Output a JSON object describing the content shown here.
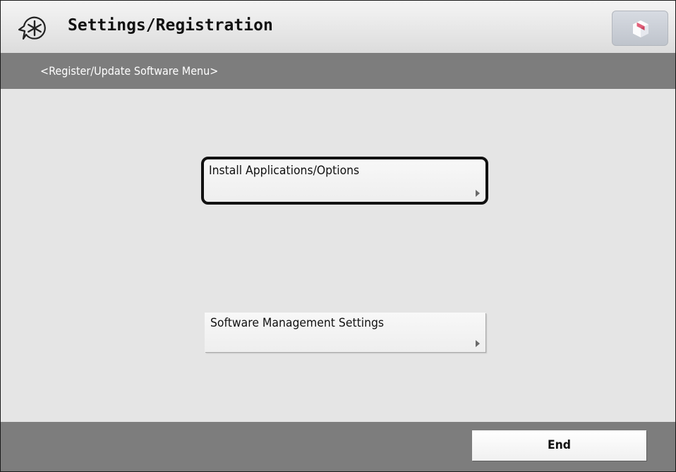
{
  "header": {
    "title": "Settings/Registration",
    "icon": "settings-asterisk-icon",
    "corner_icon": "box-icon"
  },
  "subheader": {
    "text": "<Register/Update Software Menu>"
  },
  "menu": {
    "items": [
      {
        "label": "Install Applications/Options",
        "selected": true
      },
      {
        "label": "Software Management Settings",
        "selected": false
      }
    ]
  },
  "footer": {
    "end_label": "End"
  },
  "colors": {
    "bars": "#7d7d7d",
    "content_bg": "#e5e5e5"
  }
}
